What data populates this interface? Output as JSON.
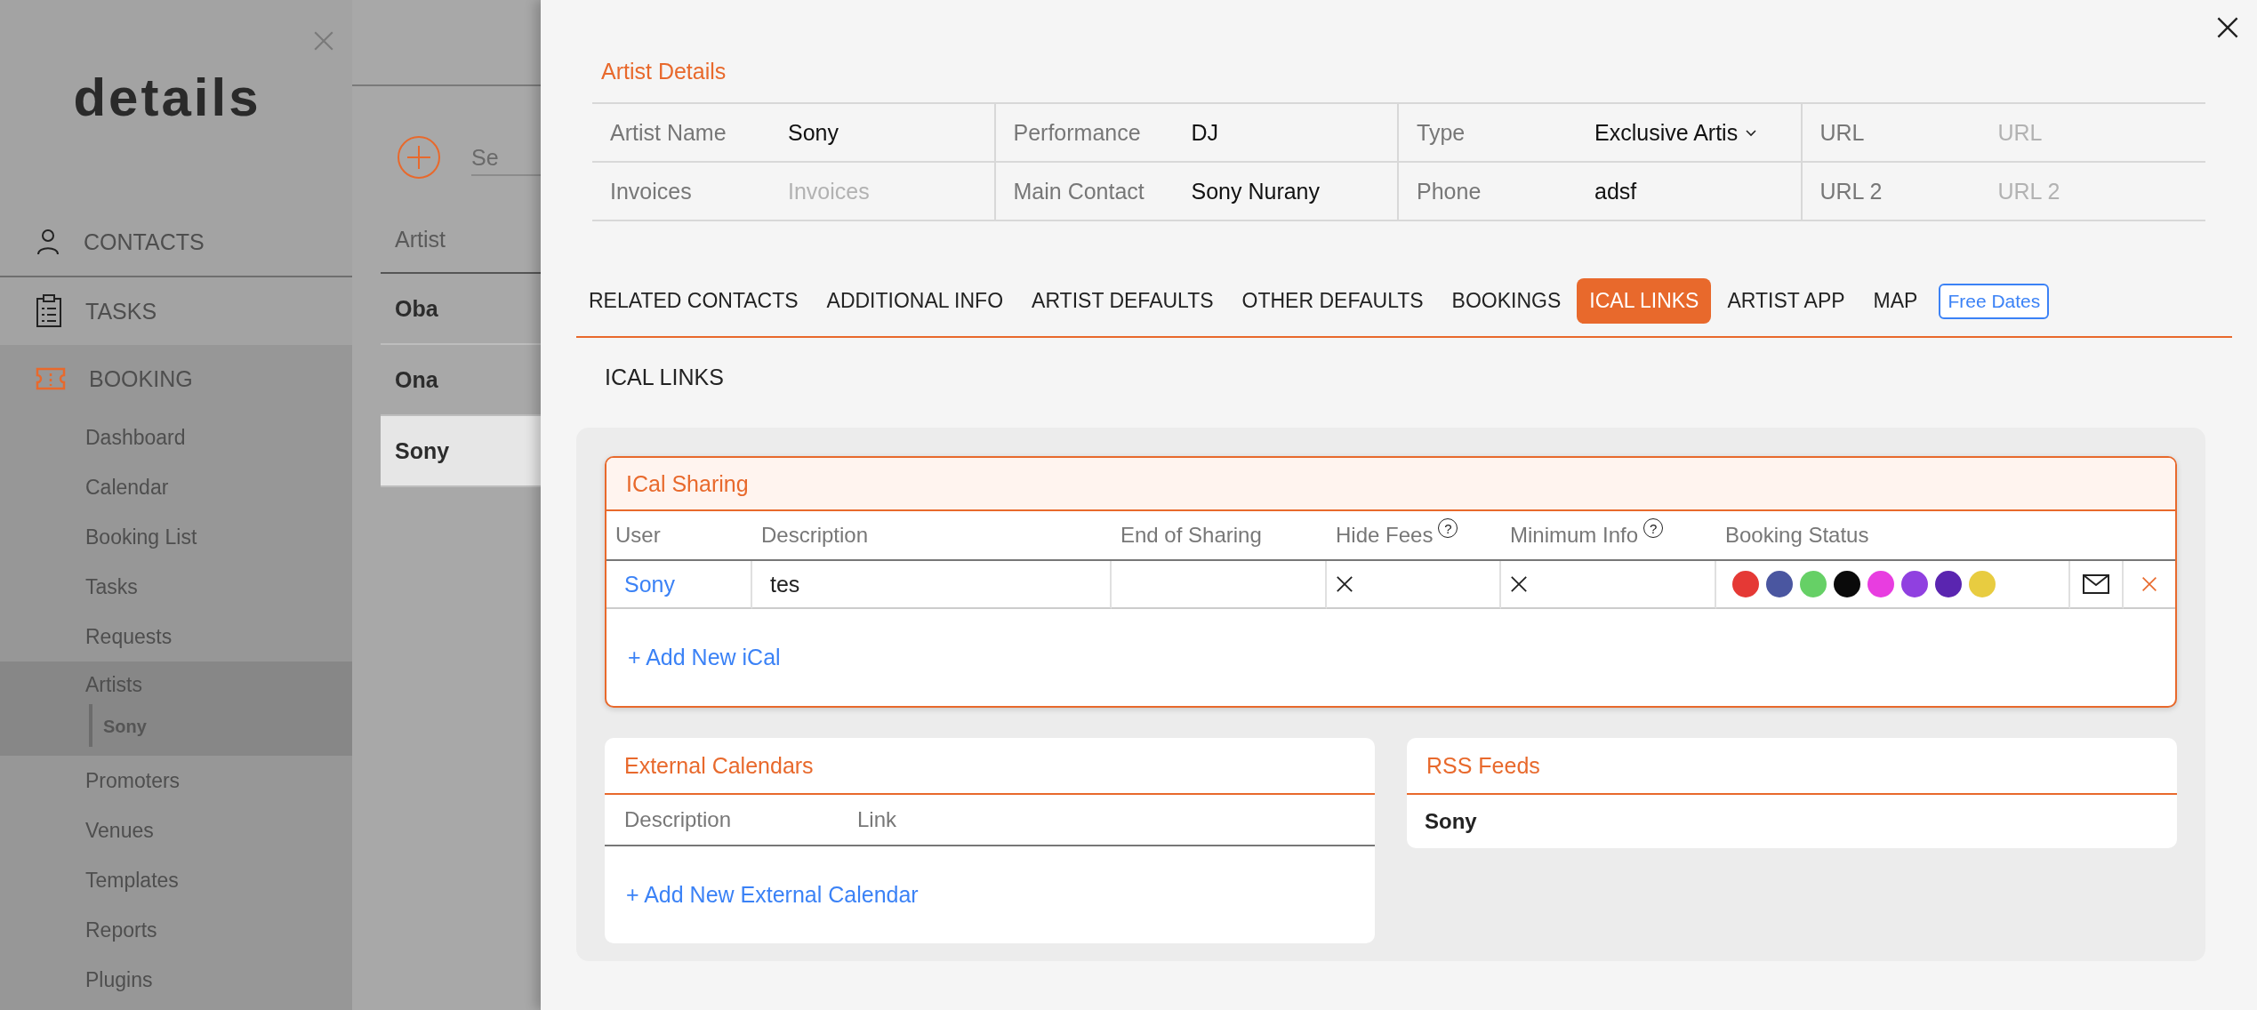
{
  "sidebar": {
    "logo": "details",
    "nav": [
      {
        "label": "CONTACTS",
        "kind": "person"
      },
      {
        "label": "TASKS",
        "kind": "clipboard"
      },
      {
        "label": "BOOKING",
        "kind": "ticket",
        "children": [
          {
            "label": "Dashboard",
            "selected": false
          },
          {
            "label": "Calendar",
            "selected": false
          },
          {
            "label": "Booking List",
            "selected": false
          },
          {
            "label": "Tasks",
            "selected": false
          },
          {
            "label": "Requests",
            "selected": false
          },
          {
            "label": "Artists",
            "selected": true,
            "children": [
              {
                "label": "Sony",
                "selected": true
              }
            ]
          },
          {
            "label": "Promoters",
            "selected": false
          },
          {
            "label": "Venues",
            "selected": false
          },
          {
            "label": "Templates",
            "selected": false
          },
          {
            "label": "Reports",
            "selected": false
          },
          {
            "label": "Plugins",
            "selected": false
          }
        ]
      }
    ]
  },
  "list": {
    "search": {
      "placeholder": "Se"
    },
    "column": "Artist",
    "rows": [
      {
        "name": "Oba",
        "selected": false
      },
      {
        "name": "Ona",
        "selected": false
      },
      {
        "name": "Sony",
        "selected": true
      }
    ]
  },
  "panel": {
    "title": "Artist Details",
    "fields": [
      {
        "label": "Artist Name",
        "value": "Sony",
        "kind": "text"
      },
      {
        "label": "Performance",
        "value": "DJ",
        "kind": "text"
      },
      {
        "label": "Type",
        "value": "Exclusive Artis",
        "kind": "select"
      },
      {
        "label": "URL",
        "placeholder": "URL",
        "kind": "text"
      },
      {
        "label": "Invoices",
        "placeholder": "Invoices",
        "kind": "text"
      },
      {
        "label": "Main Contact",
        "value": "Sony Nurany",
        "kind": "text"
      },
      {
        "label": "Phone",
        "value": "adsf",
        "kind": "text"
      },
      {
        "label": "URL 2",
        "placeholder": "URL 2",
        "kind": "text"
      }
    ],
    "tabs": [
      {
        "label": "RELATED CONTACTS",
        "selected": false
      },
      {
        "label": "ADDITIONAL INFO",
        "selected": false
      },
      {
        "label": "ARTIST DEFAULTS",
        "selected": false
      },
      {
        "label": "OTHER DEFAULTS",
        "selected": false
      },
      {
        "label": "BOOKINGS",
        "selected": false
      },
      {
        "label": "ICAL LINKS",
        "selected": true
      },
      {
        "label": "ARTIST APP",
        "selected": false
      },
      {
        "label": "MAP",
        "selected": false
      }
    ],
    "free_dates_button": "Free Dates",
    "section_title": "ICAL LINKS",
    "ical_sharing": {
      "title": "ICal Sharing",
      "columns": [
        {
          "label": "User"
        },
        {
          "label": "Description"
        },
        {
          "label": "End of Sharing"
        },
        {
          "label": "Hide Fees",
          "help": "?"
        },
        {
          "label": "Minimum Info",
          "help": "?"
        },
        {
          "label": "Booking Status"
        }
      ],
      "rows": [
        {
          "user": "Sony",
          "description": "tes",
          "hide_fees": false,
          "minimum_info": false,
          "statuses": [
            {
              "color": "#e53935"
            },
            {
              "color": "#4a56a0"
            },
            {
              "color": "#66d066"
            },
            {
              "color": "#0a0a0a"
            },
            {
              "color": "#e83de0"
            },
            {
              "color": "#9040e0"
            },
            {
              "color": "#5a25b0"
            },
            {
              "color": "#e8cc40"
            }
          ]
        }
      ],
      "add_link": "+ Add New iCal"
    },
    "external_calendars": {
      "title": "External Calendars",
      "columns": [
        "Description",
        "Link"
      ],
      "add_link": "+ Add New External Calendar"
    },
    "rss_feeds": {
      "title": "RSS Feeds",
      "items": [
        "Sony"
      ]
    }
  }
}
